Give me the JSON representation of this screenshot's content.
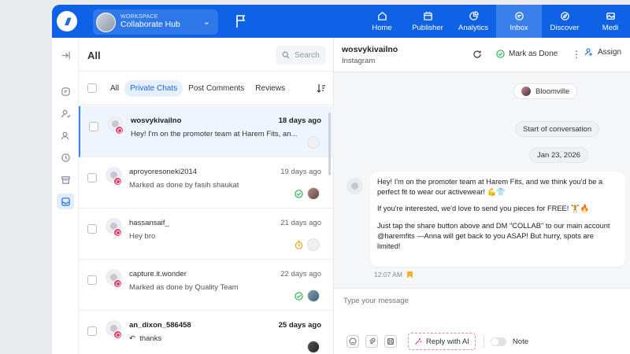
{
  "topbar": {
    "logo_mark": "///",
    "workspace_label": "WORKSPACE",
    "workspace_name": "Collaborate Hub",
    "nav": [
      {
        "label": "Home",
        "icon": "home-icon"
      },
      {
        "label": "Publisher",
        "icon": "calendar-icon"
      },
      {
        "label": "Analytics",
        "icon": "analytics-icon"
      },
      {
        "label": "Inbox",
        "icon": "inbox-icon",
        "active": true
      },
      {
        "label": "Discover",
        "icon": "compass-icon"
      },
      {
        "label": "Medi",
        "icon": "media-icon"
      }
    ]
  },
  "list": {
    "title": "All",
    "search_placeholder": "Search",
    "tabs": [
      "All",
      "Private Chats",
      "Post Comments",
      "Reviews"
    ],
    "active_tab": "Private Chats",
    "rows": [
      {
        "name": "wosvykivailno",
        "date": "18 days ago",
        "snippet": "Hey! I'm on the promoter team at Harem Fits, an...",
        "unread": true,
        "selected": true
      },
      {
        "name": "aproyoresoneki2014",
        "date": "19 days ago",
        "snippet": "Marked as done by fasih shaukat",
        "unread": false
      },
      {
        "name": "hassansaif_",
        "date": "21 days ago",
        "snippet": "Hey bro",
        "unread": false
      },
      {
        "name": "capture.it.wonder",
        "date": "22 days ago",
        "snippet": "Marked as done by Quality Team",
        "unread": false
      },
      {
        "name": "an_dixon_586458",
        "date": "25 days ago",
        "snippet": "thanks",
        "unread": true
      }
    ]
  },
  "conversation": {
    "contact_name": "wosvykivailno",
    "platform": "Instagram",
    "mark_done_label": "Mark as Done",
    "assign_label": "Assign",
    "page_name": "Bloomville",
    "start_label": "Start of conversation",
    "date_label": "Jan 23, 2026",
    "message_paragraphs": [
      "Hey! I'm on the promoter team at Harem Fits, and we think you'd be a perfect fit to wear our activewear! 💪👕",
      "If you're interested, we'd love to send you  pieces for FREE! 🏋️🔥",
      "Just tap the share button above and DM \"COLLAB\" to our main account @haremfits —Anna will get back to you ASAP! But hurry, spots are limited!"
    ],
    "message_time": "12:07 AM",
    "composer_placeholder": "Type your message",
    "reply_ai_label": "Reply with AI",
    "note_label": "Note"
  },
  "colors": {
    "brand": "#0f62e6",
    "instagram_badge": "#e23a63",
    "done_green": "#2bb24c",
    "snooze_orange": "#f2a31a"
  }
}
